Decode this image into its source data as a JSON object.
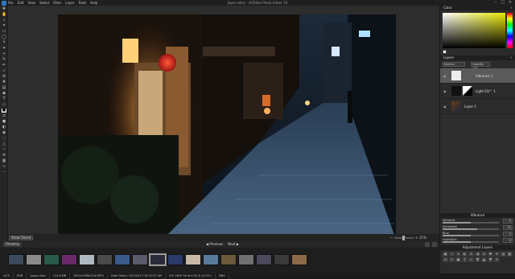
{
  "app": {
    "title": "Japan-alley - ACDSee Photo Editor 10"
  },
  "menu": [
    "File",
    "Edit",
    "View",
    "Select",
    "Filter",
    "Layer",
    "Tools",
    "Help"
  ],
  "statusstrip": {
    "show_saved": "Show Saved",
    "zoom": "21%"
  },
  "filmstrip": {
    "tab": "Filmstrip",
    "previous": "Previous",
    "next": "Next",
    "thumb_count": 17,
    "selected_index": 8
  },
  "colors": {
    "accent": "#2f76c9",
    "selected_layer": "#5a5a5a"
  },
  "panels": {
    "color": {
      "title": "Color"
    },
    "layers": {
      "title": "Layers",
      "blend_mode": "Normal",
      "opacity": "Opacity: 100",
      "items": [
        {
          "name": "Vibrance 1",
          "selected": true
        },
        {
          "name": "Light EQ™ 1",
          "selected": false
        },
        {
          "name": "Layer 1",
          "selected": false
        }
      ]
    },
    "vibrance": {
      "title": "Vibrance",
      "rows": [
        {
          "label": "Vibrance",
          "value": "0",
          "fraction": 0.5
        },
        {
          "label": "Saturation",
          "value": "25",
          "fraction": 0.62
        },
        {
          "label": "Blue",
          "value": "0",
          "fraction": 0.5
        },
        {
          "label": "Highlights",
          "value": "0",
          "fraction": 0.5
        }
      ]
    },
    "adjustment_layers": {
      "title": "Adjustment Layers"
    }
  },
  "statusbar": [
    "4/15",
    "RGB",
    "Japan-alley",
    "124.8 MB",
    "5622x3966x32b JPEG",
    "Date Taken: 10/7/2013 10:52:57 AM",
    "ISO 1600  56 mm  f/2.8  1/125 s",
    "DNG"
  ]
}
